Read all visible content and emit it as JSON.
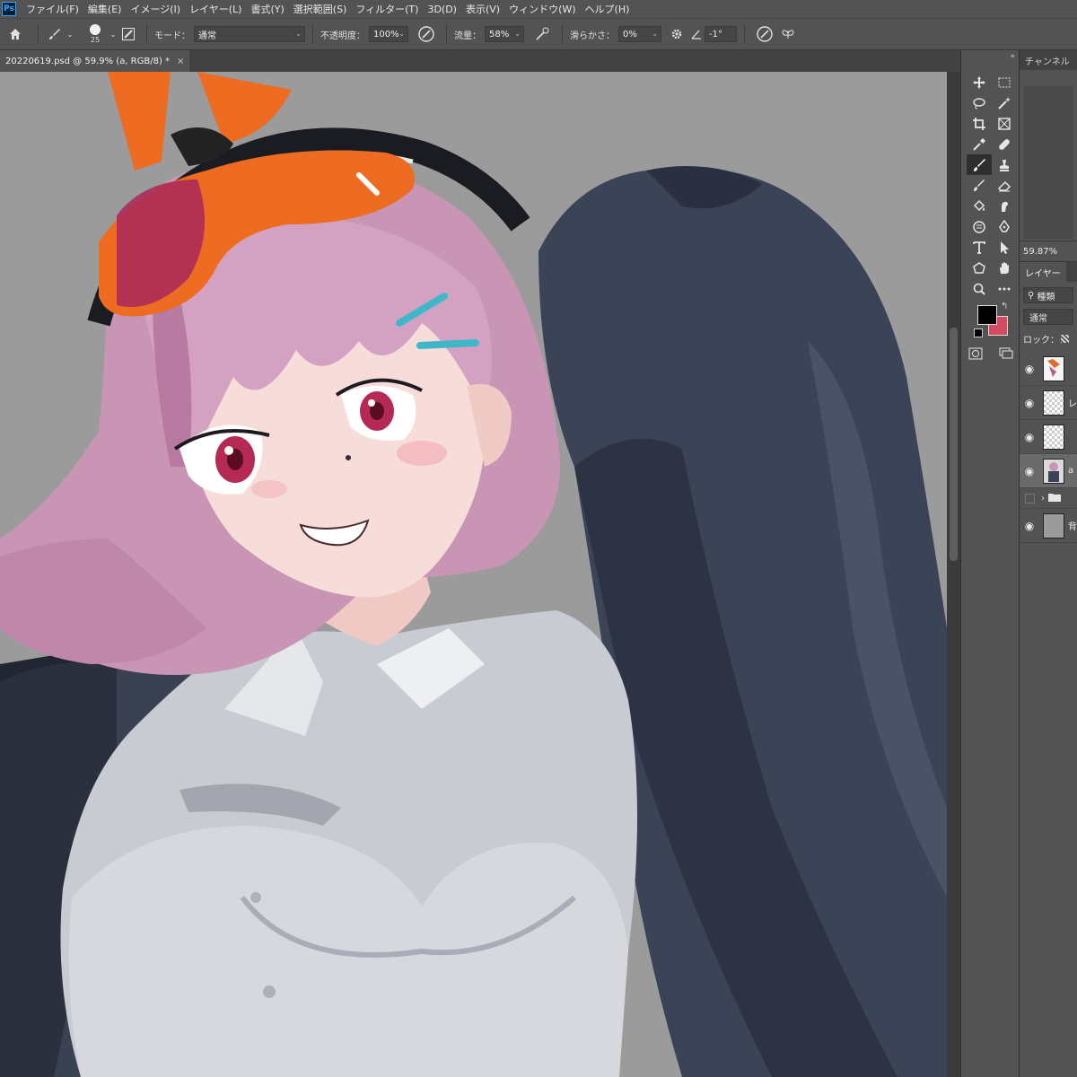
{
  "app": {
    "logo_text": "Ps"
  },
  "menu": {
    "items": [
      "ファイル(F)",
      "編集(E)",
      "イメージ(I)",
      "レイヤー(L)",
      "書式(Y)",
      "選択範囲(S)",
      "フィルター(T)",
      "3D(D)",
      "表示(V)",
      "ウィンドウ(W)",
      "ヘルプ(H)"
    ]
  },
  "options": {
    "brush_size": "25",
    "mode_label": "モード：",
    "mode_value": "通常",
    "opacity_label": "不透明度：",
    "opacity_value": "100%",
    "flow_label": "流量：",
    "flow_value": "58%",
    "smoothing_label": "滑らかさ：",
    "smoothing_value": "0%",
    "angle_value": "-1°"
  },
  "document": {
    "tab_title": "20220619.psd @ 59.9% (a, RGB/8) *",
    "close_glyph": "×"
  },
  "colors": {
    "foreground": "#000000",
    "background": "#d64a62"
  },
  "right_panel": {
    "channels_tab": "チャンネル",
    "zoom": "59.87%",
    "layers_tab": "レイヤー",
    "search_placeholder": "種類",
    "blend_mode": "通常",
    "lock_label": "ロック：",
    "layers": [
      {
        "name": "",
        "thumb": "drawing",
        "visible": true
      },
      {
        "name": "レ",
        "thumb": "transparent",
        "visible": true
      },
      {
        "name": "",
        "thumb": "transparent",
        "visible": true
      },
      {
        "name": "a",
        "thumb": "character",
        "visible": true,
        "selected": true
      },
      {
        "name": "",
        "thumb": "folder",
        "visible": false
      },
      {
        "name": "背",
        "thumb": "gray",
        "visible": true
      }
    ]
  }
}
